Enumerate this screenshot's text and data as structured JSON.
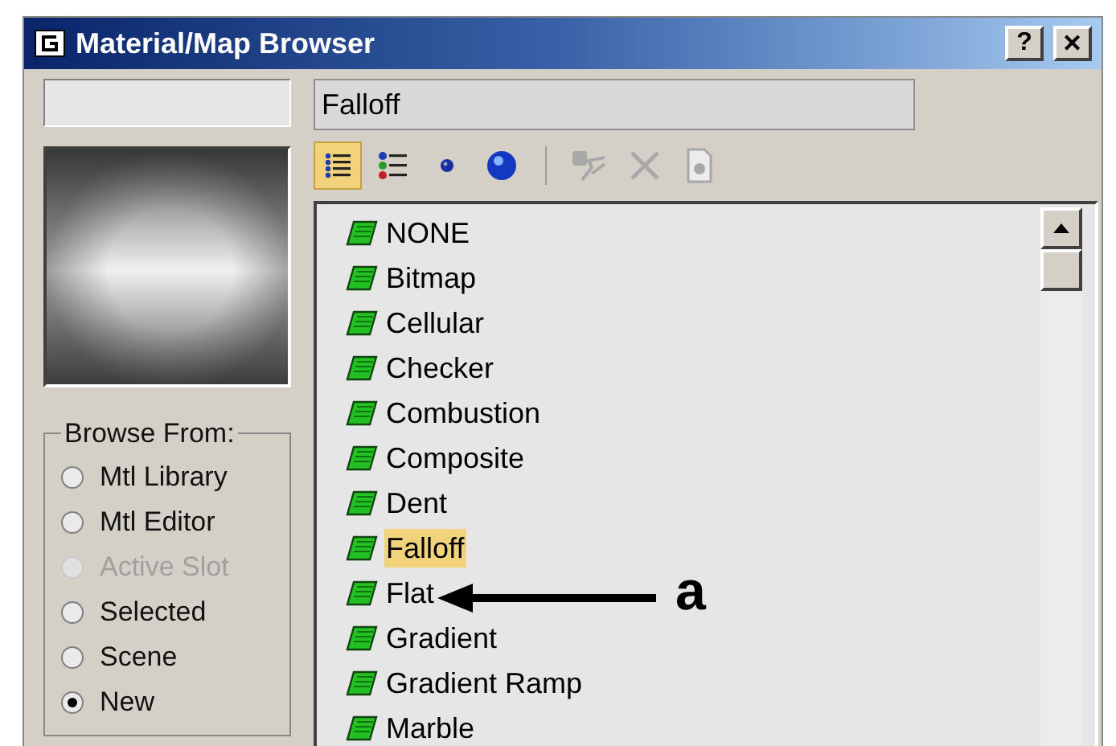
{
  "window": {
    "title": "Material/Map Browser",
    "help_button": "?",
    "close_button": "✕"
  },
  "type_field": {
    "value": "Falloff"
  },
  "view_buttons": [
    {
      "kind": "list-text",
      "selected": true
    },
    {
      "kind": "list-icons",
      "selected": false
    },
    {
      "kind": "small-icons",
      "selected": false
    },
    {
      "kind": "large-icons",
      "selected": false
    }
  ],
  "action_buttons": [
    {
      "kind": "update",
      "disabled": true
    },
    {
      "kind": "delete",
      "disabled": true
    },
    {
      "kind": "clear",
      "disabled": true
    }
  ],
  "browse_from": {
    "title": "Browse From:",
    "options": [
      {
        "label": "Mtl Library",
        "selected": false,
        "disabled": false
      },
      {
        "label": "Mtl Editor",
        "selected": false,
        "disabled": false
      },
      {
        "label": "Active Slot",
        "selected": false,
        "disabled": true
      },
      {
        "label": "Selected",
        "selected": false,
        "disabled": false
      },
      {
        "label": "Scene",
        "selected": false,
        "disabled": false
      },
      {
        "label": "New",
        "selected": true,
        "disabled": false
      }
    ]
  },
  "maps": [
    {
      "label": "NONE",
      "selected": false
    },
    {
      "label": "Bitmap",
      "selected": false
    },
    {
      "label": "Cellular",
      "selected": false
    },
    {
      "label": "Checker",
      "selected": false
    },
    {
      "label": "Combustion",
      "selected": false
    },
    {
      "label": "Composite",
      "selected": false
    },
    {
      "label": "Dent",
      "selected": false
    },
    {
      "label": "Falloff",
      "selected": true
    },
    {
      "label": "Flat",
      "selected": false
    },
    {
      "label": "Gradient",
      "selected": false
    },
    {
      "label": "Gradient Ramp",
      "selected": false
    },
    {
      "label": "Marble",
      "selected": false
    }
  ],
  "annotation": {
    "label": "a"
  }
}
